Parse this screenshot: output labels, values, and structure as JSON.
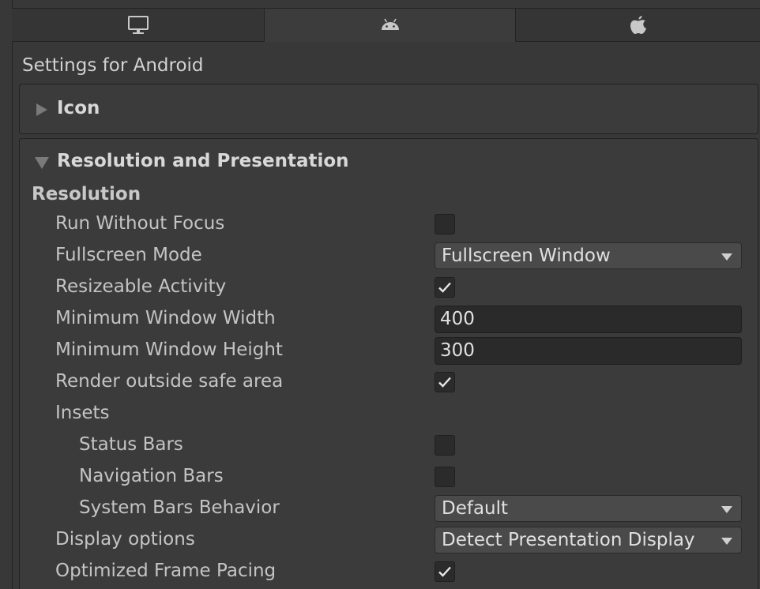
{
  "tabs": [
    {
      "icon": "desktop-monitor-icon",
      "active": false
    },
    {
      "icon": "android-icon",
      "active": true
    },
    {
      "icon": "apple-icon",
      "active": false
    }
  ],
  "settings_title": "Settings for Android",
  "panels": {
    "icon": {
      "label": "Icon",
      "expanded": false
    },
    "resolution_presentation": {
      "label": "Resolution and Presentation",
      "expanded": true
    }
  },
  "resolution": {
    "group_title": "Resolution",
    "run_without_focus": {
      "label": "Run Without Focus",
      "checked": false
    },
    "fullscreen_mode": {
      "label": "Fullscreen Mode",
      "value": "Fullscreen Window"
    },
    "resizeable_activity": {
      "label": "Resizeable Activity",
      "checked": true
    },
    "min_window_width": {
      "label": "Minimum Window Width",
      "value": "400"
    },
    "min_window_height": {
      "label": "Minimum Window Height",
      "value": "300"
    },
    "render_outside_safe_area": {
      "label": "Render outside safe area",
      "checked": true
    },
    "insets_label": "Insets",
    "status_bars": {
      "label": "Status Bars",
      "checked": false
    },
    "navigation_bars": {
      "label": "Navigation Bars",
      "checked": false
    },
    "system_bars_behavior": {
      "label": "System Bars Behavior",
      "value": "Default"
    },
    "display_options": {
      "label": "Display options",
      "value": "Detect Presentation Display"
    },
    "optimized_frame_pacing": {
      "label": "Optimized Frame Pacing",
      "checked": true
    }
  },
  "colors": {
    "background": "#383838",
    "panel": "#3b3b3b",
    "field": "#2a2a2a",
    "dropdown": "#4a4a4a",
    "text": "#c4c4c4"
  }
}
